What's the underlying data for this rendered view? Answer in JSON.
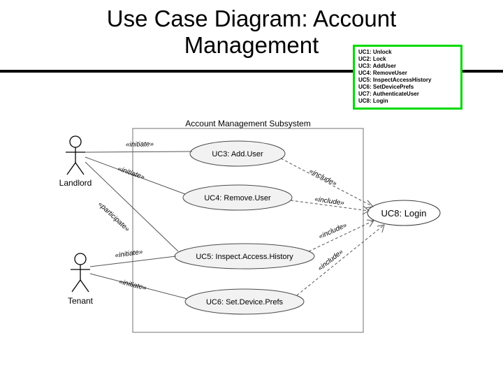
{
  "title": "Use Case Diagram: Account Management",
  "legend": {
    "items": [
      "UC1: Unlock",
      "UC2: Lock",
      "UC3: AddUser",
      "UC4: RemoveUser",
      "UC5: InspectAccessHistory",
      "UC6: SetDevicePrefs",
      "UC7: AuthenticateUser",
      "UC8: Login"
    ]
  },
  "diagram": {
    "system_name": "Account Management Subsystem",
    "actors": {
      "landlord": "Landlord",
      "tenant": "Tenant"
    },
    "usecases": {
      "uc3": "UC3: Add.User",
      "uc4": "UC4: Remove.User",
      "uc5": "UC5: Inspect.Access.History",
      "uc6": "UC6: Set.Device.Prefs",
      "uc8": "UC8: Login"
    },
    "stereotypes": {
      "initiate": "«initiate»",
      "participate": "«participate»",
      "include": "«include»"
    }
  }
}
